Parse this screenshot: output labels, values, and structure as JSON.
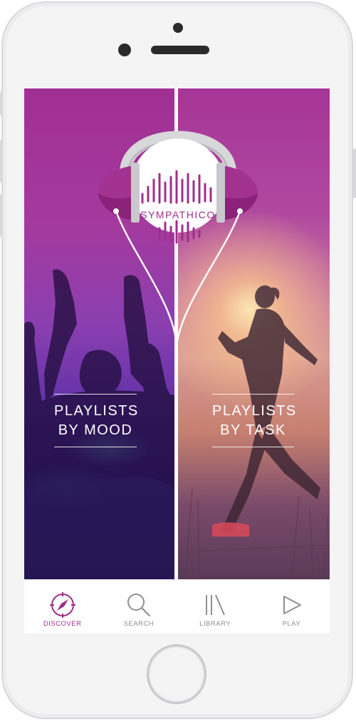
{
  "app": {
    "brand_name": "SYMPATHICO",
    "brand_color": "#9e2f8c"
  },
  "categories": {
    "mood": {
      "line1": "PLAYLISTS",
      "line2": "BY MOOD"
    },
    "task": {
      "line1": "PLAYLISTS",
      "line2": "BY TASK"
    }
  },
  "tabs": [
    {
      "label": "DISCOVER",
      "icon": "compass-icon",
      "active": true
    },
    {
      "label": "SEARCH",
      "icon": "magnifier-icon",
      "active": false
    },
    {
      "label": "LIBRARY",
      "icon": "library-icon",
      "active": false
    },
    {
      "label": "PLAY",
      "icon": "play-icon",
      "active": false
    }
  ],
  "colors": {
    "active_tab": "#9e2f8c",
    "inactive_tab": "#8f8f94"
  }
}
